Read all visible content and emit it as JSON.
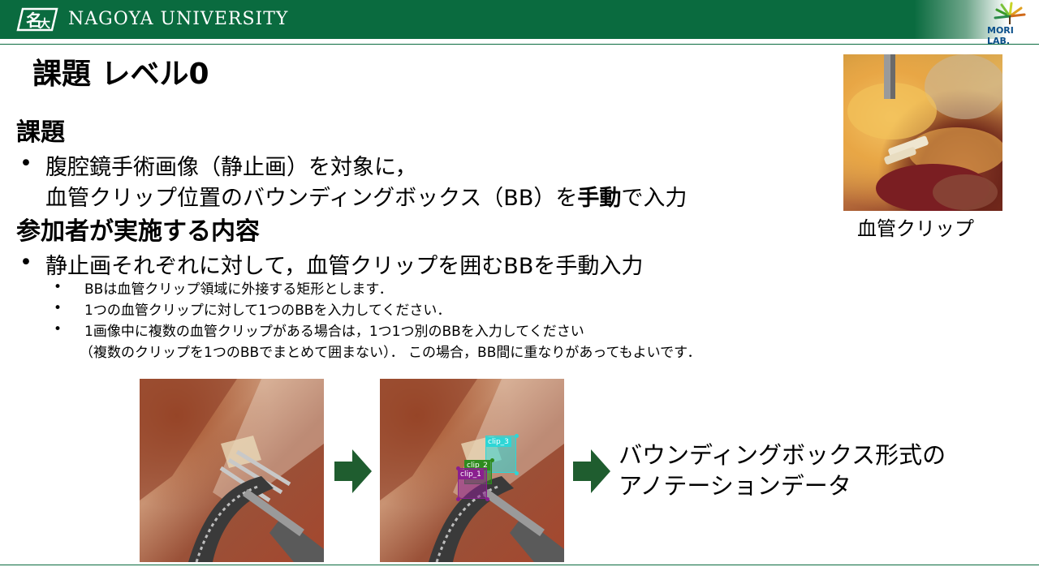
{
  "header": {
    "university": "NAGOYA UNIVERSITY",
    "lab": "MORI LAB."
  },
  "slide": {
    "title": "課題 レベル0",
    "section1": {
      "heading": "課題",
      "bullet": "•",
      "line1": "腹腔鏡手術画像（静止画）を対象に，",
      "line2_pre": "血管クリップ位置のバウンディングボックス（BB）を",
      "line2_bold": "手動",
      "line2_post": "で入力"
    },
    "section2": {
      "heading": "参加者が実施する内容",
      "bullet": "•",
      "line1": "静止画それぞれに対して，血管クリップを囲むBBを手動入力",
      "subs": [
        "BBは血管クリップ領域に外接する矩形とします．",
        "1つの血管クリップに対して1つのBBを入力してください．",
        "1画像中に複数の血管クリップがある場合は，1つ1つ別のBBを入力してください",
        "（複数のクリップを1つのBBでまとめて囲まない）． この場合，BB間に重なりがあってもよいです．"
      ],
      "sub_bullet": "•"
    },
    "photo_caption": "血管クリップ",
    "annotations": {
      "clip1": "clip_1",
      "clip2": "clip_2",
      "clip3": "clip_3"
    },
    "result": {
      "line1": "バウンディングボックス形式の",
      "line2": "アノテーションデータ"
    }
  },
  "colors": {
    "brand_green": "#0a6b3f",
    "arrow_green": "#1f5d2f",
    "clip1": "#8a1f8f",
    "clip2": "#2e8b1e",
    "clip3": "#2ed6d6"
  }
}
